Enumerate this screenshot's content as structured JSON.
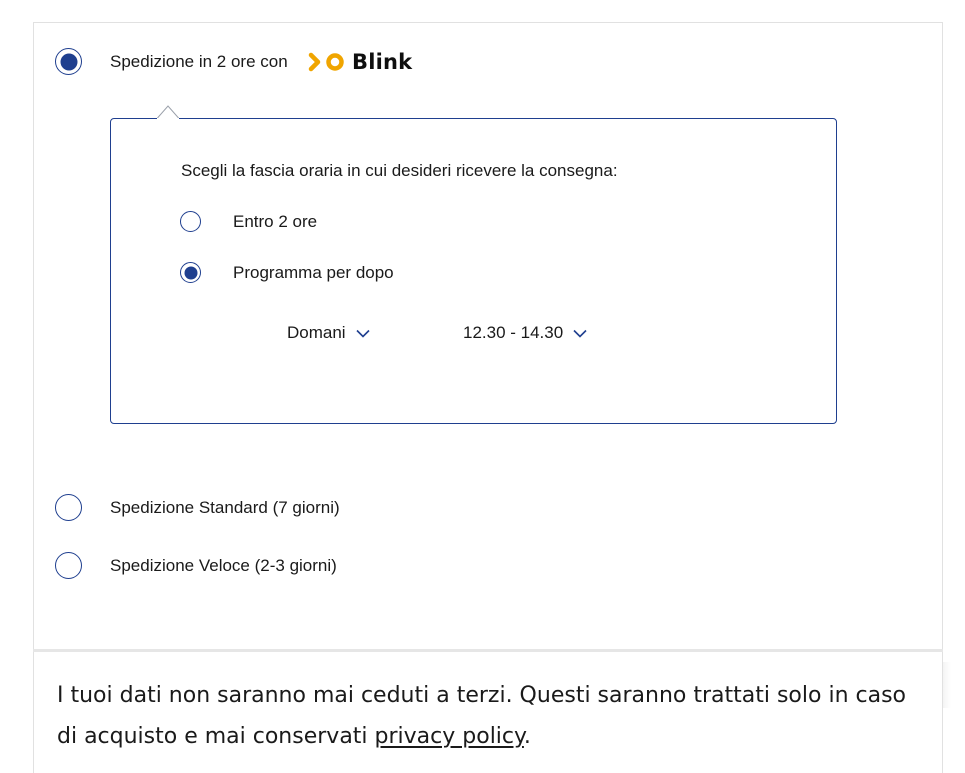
{
  "shipping_options": {
    "blink": {
      "label": "Spedizione in 2 ore con",
      "brand": "Blink",
      "selected": true
    },
    "standard": {
      "label": "Spedizione Standard (7 giorni)",
      "selected": false
    },
    "express": {
      "label": "Spedizione Veloce (2-3 giorni)",
      "selected": false
    }
  },
  "time_slot": {
    "prompt": "Scegli la fascia oraria in cui desideri ricevere la consegna:",
    "options": [
      {
        "label": "Entro 2 ore",
        "selected": false
      },
      {
        "label": "Programma per dopo",
        "selected": true
      }
    ],
    "day_select": {
      "value": "Domani"
    },
    "time_select": {
      "value": "12.30 - 14.30"
    }
  },
  "footer": {
    "text": "I tuoi dati non saranno mai ceduti a terzi. Questi saranno trattati solo in caso di acquisto e mai conservati ",
    "link": "privacy policy",
    "end": "."
  },
  "colors": {
    "accent": "#1f3f8f",
    "brand_orange": "#f0a500",
    "border": "#e1e1e1"
  },
  "icons": [
    "blink-chevron-icon",
    "blink-ring-icon",
    "chevron-down-icon"
  ]
}
